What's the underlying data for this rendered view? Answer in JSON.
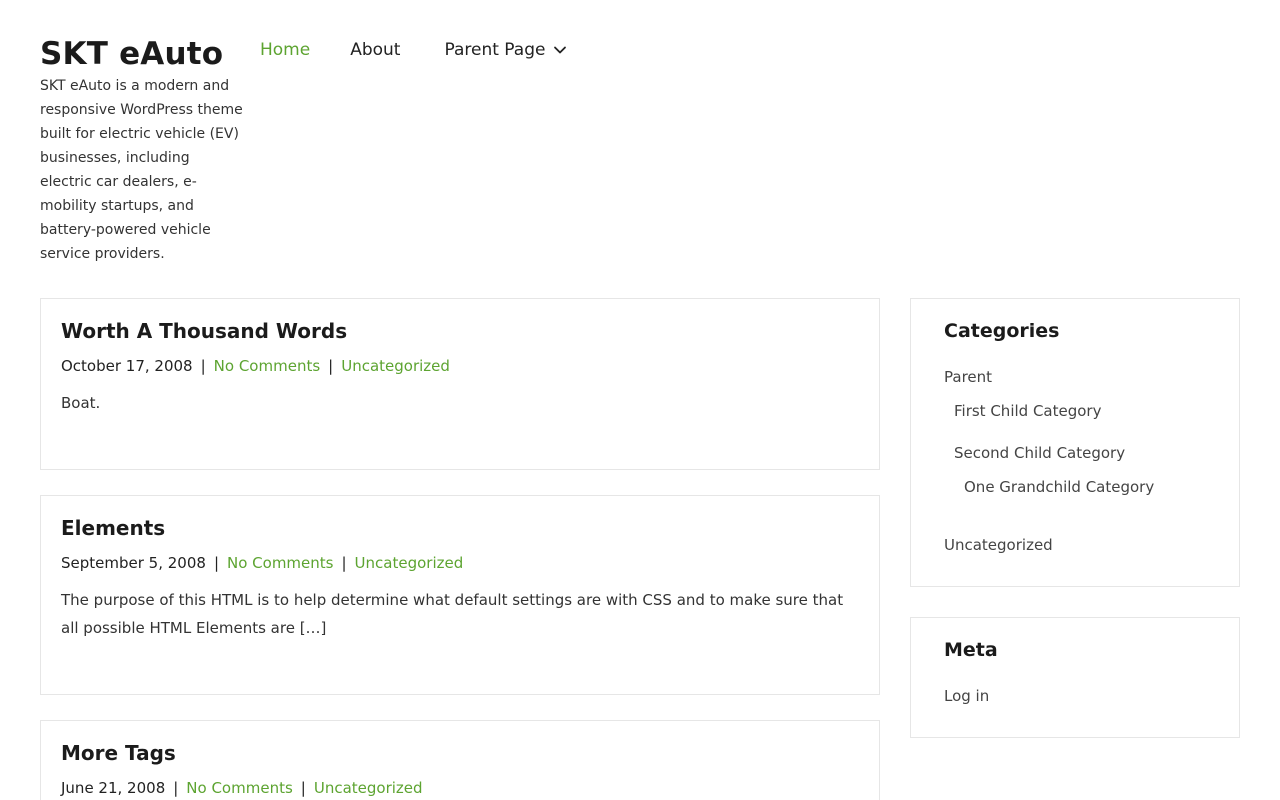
{
  "site": {
    "title": "SKT eAuto",
    "description": "SKT eAuto is a modern and responsive WordPress theme built for electric vehicle (EV) businesses, including electric car dealers, e-mobility startups, and battery-powered vehicle service providers."
  },
  "nav": {
    "items": [
      {
        "label": "Home",
        "active": true
      },
      {
        "label": "About",
        "active": false
      },
      {
        "label": "Parent Page",
        "active": false,
        "has_submenu": true
      }
    ]
  },
  "posts": [
    {
      "title": "Worth A Thousand Words",
      "date": "October 17, 2008",
      "comments": "No Comments",
      "category": "Uncategorized",
      "excerpt": "Boat."
    },
    {
      "title": "Elements",
      "date": "September 5, 2008",
      "comments": "No Comments",
      "category": "Uncategorized",
      "excerpt": "The purpose of this HTML is to help determine what default settings are with CSS and to make sure that all possible HTML Elements are […]"
    },
    {
      "title": "More Tags",
      "date": "June 21, 2008",
      "comments": "No Comments",
      "category": "Uncategorized",
      "excerpt": ""
    }
  ],
  "meta_separator": "|",
  "sidebar": {
    "categories": {
      "title": "Categories",
      "items": [
        {
          "label": "Parent",
          "level": 0
        },
        {
          "label": "First Child Category",
          "level": 1
        },
        {
          "label": "Second Child Category",
          "level": 1
        },
        {
          "label": "One Grandchild Category",
          "level": 2
        },
        {
          "label": "Uncategorized",
          "level": 0
        }
      ]
    },
    "meta": {
      "title": "Meta",
      "items": [
        {
          "label": "Log in"
        }
      ]
    }
  },
  "colors": {
    "accent": "#5da431",
    "text": "#222222",
    "border": "#e6e6e6"
  }
}
